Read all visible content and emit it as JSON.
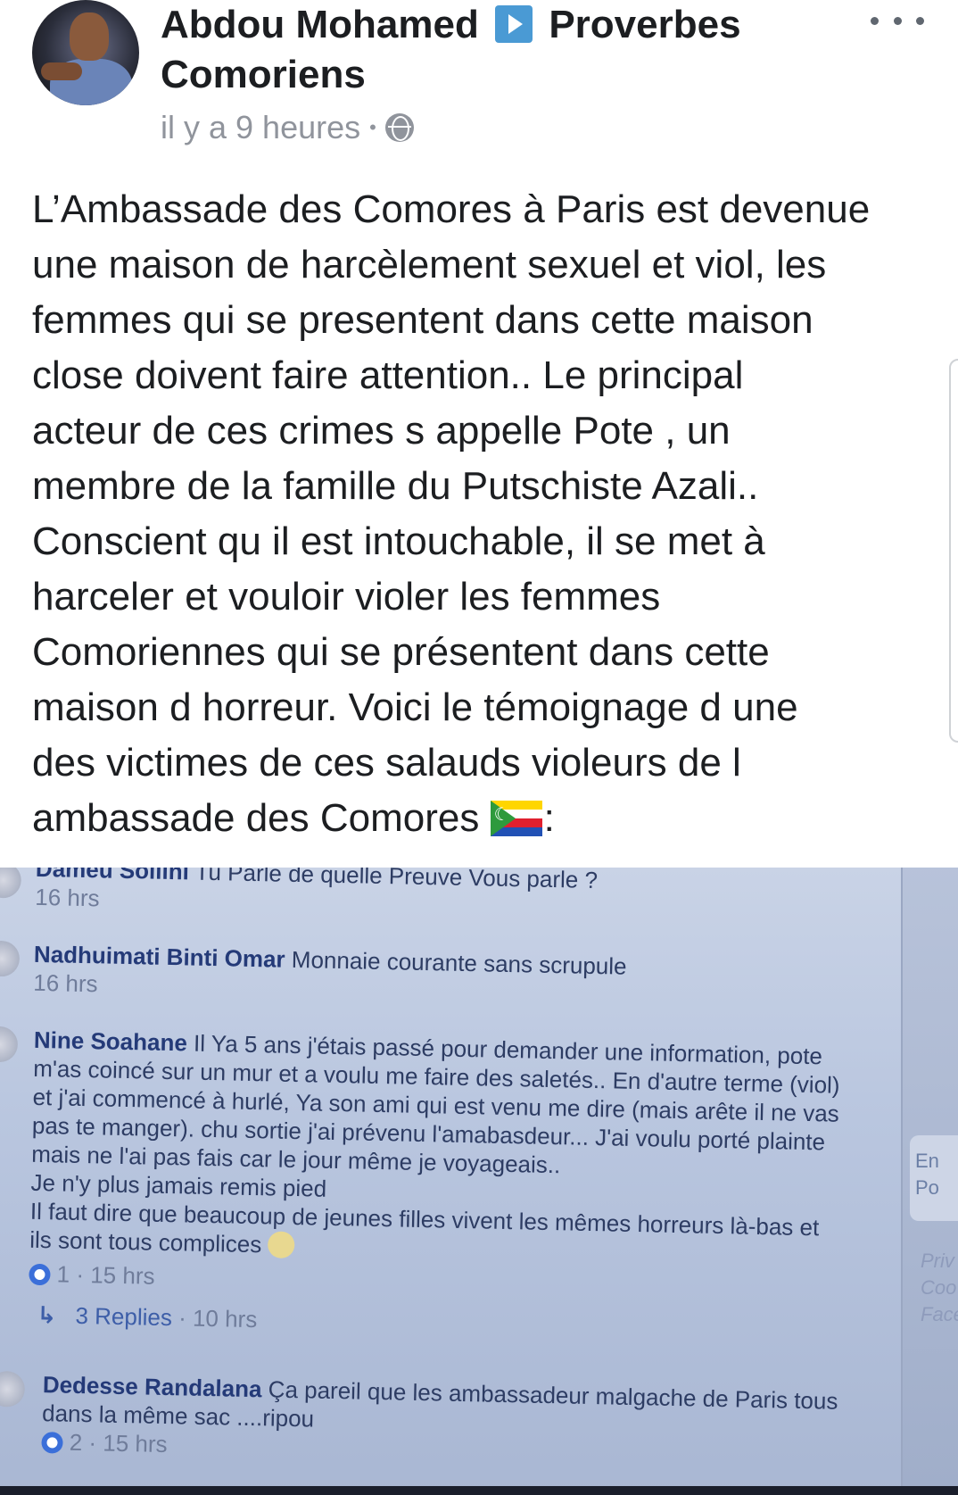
{
  "post": {
    "author": "Abdou Mohamed",
    "target_page": "Proverbes Comoriens",
    "timestamp": "il y a 9 heures",
    "separator": "•",
    "privacy_icon": "globe-icon",
    "more_icon": "more-options-icon",
    "body_lines": [
      "L’Ambassade des Comores à Paris est devenue",
      "une maison de harcèlement sexuel et viol, les",
      "femmes qui se presentent dans cette maison",
      "close doivent faire attention.. Le principal",
      "acteur de ces crimes s appelle Pote , un",
      "membre de la famille du Putschiste Azali..",
      "Conscient qu il est intouchable, il se met à",
      "harceler et vouloir violer les femmes",
      "Comoriennes qui se présentent dans cette",
      "maison d horreur. Voici le témoignage d une",
      "des victimes de ces salauds violeurs de l"
    ],
    "last_line": "ambassade des Comores",
    "last_line_suffix": ":",
    "flag_icon": "comoros-flag-icon"
  },
  "photo": {
    "comments": [
      {
        "name": "Dameu Soilihi",
        "text": "Tu Parle de quelle Preuve Vous parle ?",
        "time": "16 hrs"
      },
      {
        "name": "Nadhuimati Binti Omar",
        "text": "Monnaie courante sans scrupule",
        "time": "16 hrs"
      },
      {
        "name": "Nine Soahane",
        "text_lines": [
          "Il Ya 5 ans j'étais passé pour demander une information, pote",
          "m'as coincé sur un mur et a voulu me faire des saletés.. En d'autre terme (viol)",
          "et j'ai commencé à hurlé, Ya son ami qui est venu me dire (mais arête il ne vas",
          "pas te manger). chu sortie j'ai prévenu l'amabasdeur... J'ai voulu porté plainte",
          "mais ne l'ai pas fais car le jour même je voyageais..",
          "Je n'y plus jamais remis pied",
          "Il faut dire que beaucoup de jeunes filles vivent les mêmes horreurs là-bas et",
          "ils sont tous complices"
        ],
        "likes": "1",
        "time": "· 15 hrs",
        "replies": "3 Replies",
        "replies_time": "· 10 hrs"
      },
      {
        "name": "Dedesse Randalana",
        "text_lines": [
          "Ça pareil que les ambassadeur malgache de Paris tous",
          "dans la même sac ....ripou"
        ],
        "likes": "2",
        "time": "· 15 hrs"
      }
    ],
    "side_button_lines": [
      "En",
      "Po"
    ],
    "side_links": [
      "Priv",
      "Coo",
      "Face"
    ]
  }
}
